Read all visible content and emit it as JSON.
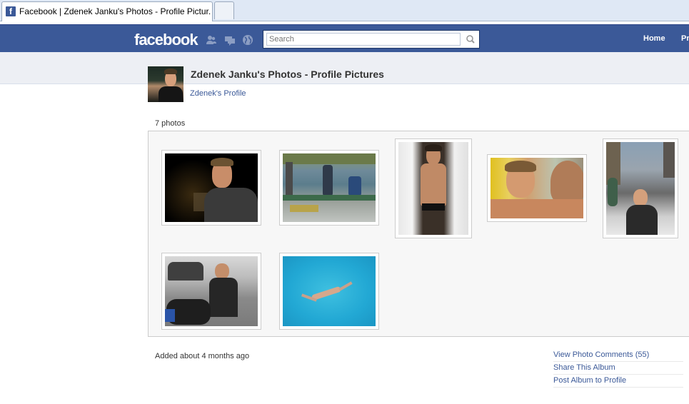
{
  "browser": {
    "tab_title": "Facebook | Zdenek Janku's Photos - Profile Pictur..."
  },
  "header": {
    "logo": "facebook",
    "search_placeholder": "Search",
    "nav": {
      "home": "Home",
      "profile_partial": "Pr"
    },
    "icons": [
      "friends-icon",
      "messages-icon",
      "notifications-globe-icon",
      "search-magnifier-icon"
    ]
  },
  "album": {
    "title": "Zdenek Janku's Photos - Profile Pictures",
    "profile_link": "Zdenek's Profile",
    "photo_count": "7 photos",
    "added": "Added about 4 months ago"
  },
  "actions": [
    "View Photo Comments (55)",
    "Share This Album",
    "Post Album to Profile"
  ],
  "colors": {
    "facebook_blue": "#3b5998",
    "link_blue": "#3b5998",
    "subheader_gray": "#edeff4"
  }
}
